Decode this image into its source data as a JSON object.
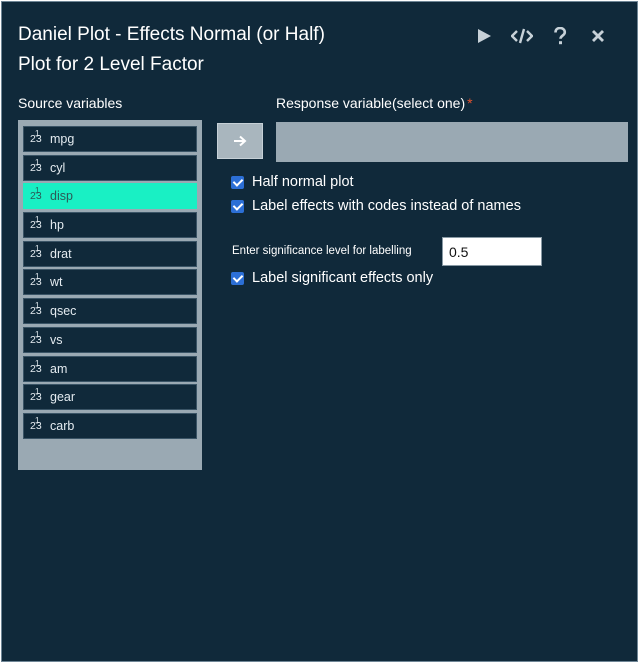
{
  "dialog": {
    "title_line1": "Daniel Plot - Effects Normal (or Half)",
    "title_line2": "Plot for 2 Level Factor"
  },
  "toolbar": {
    "icons": [
      "play-icon",
      "code-icon",
      "help-icon",
      "close-icon"
    ]
  },
  "source": {
    "label": "Source variables",
    "type_icon_base": "2",
    "type_icon_sup": "1",
    "type_icon_sub": "3",
    "selected": "disp",
    "items": [
      "mpg",
      "cyl",
      "disp",
      "hp",
      "drat",
      "wt",
      "qsec",
      "vs",
      "am",
      "gear",
      "carb"
    ]
  },
  "response": {
    "label": "Response variable(select one)",
    "required_mark": "*",
    "value": ""
  },
  "options": {
    "half_normal": {
      "label": "Half normal plot",
      "checked": true
    },
    "label_codes": {
      "label": "Label effects with codes instead of names",
      "checked": true
    },
    "sig_level": {
      "label": "Enter significance level for labelling",
      "value": "0.5"
    },
    "label_sig_only": {
      "label": "Label significant effects only",
      "checked": true
    }
  },
  "colors": {
    "background": "#10293a",
    "panel": "#9aa9b3",
    "selected": "#19f0c4",
    "checkbox": "#2c6fd6",
    "required": "#e4532f"
  }
}
